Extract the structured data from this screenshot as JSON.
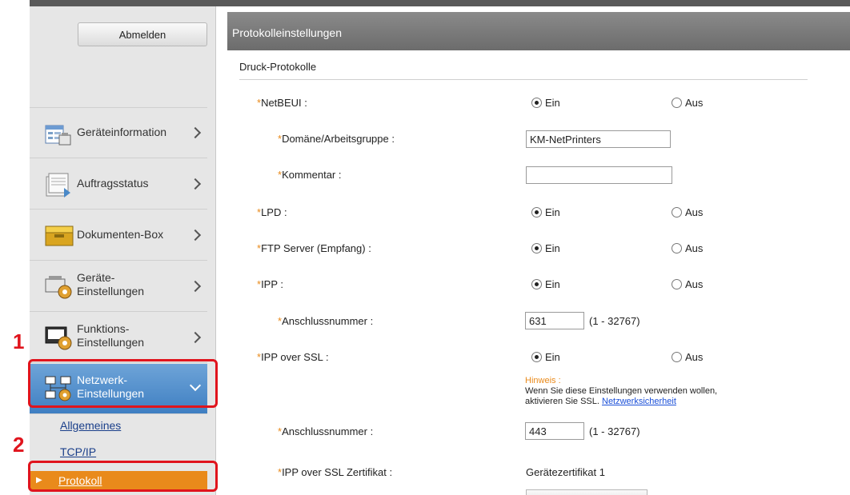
{
  "sidebar": {
    "logout_label": "Abmelden",
    "items": [
      {
        "label": "Geräteinformation",
        "icon": "device-info-icon"
      },
      {
        "label": "Auftragsstatus",
        "icon": "job-status-icon"
      },
      {
        "label": "Dokumenten-Box",
        "icon": "document-box-icon"
      },
      {
        "label_line1": "Geräte-",
        "label_line2": "Einstellungen",
        "icon": "device-settings-icon"
      },
      {
        "label_line1": "Funktions-",
        "label_line2": "Einstellungen",
        "icon": "function-settings-icon"
      },
      {
        "label_line1": "Netzwerk-",
        "label_line2": "Einstellungen",
        "icon": "network-settings-icon",
        "active": true
      }
    ],
    "sub_items": [
      "Allgemeines",
      "TCP/IP",
      "Protokoll"
    ],
    "active_sub_item": "Protokoll"
  },
  "callouts": [
    "1",
    "2"
  ],
  "panel": {
    "title": "Protokolleinstellungen",
    "section_title": "Druck-Protokolle",
    "required_mark": "*",
    "radio_on": "Ein",
    "radio_off": "Aus",
    "rows": {
      "netbeui": "NetBEUI :",
      "domain": "Domäne/Arbeitsgruppe :",
      "domain_value": "KM-NetPrinters",
      "comment": "Kommentar :",
      "comment_value": "",
      "lpd": "LPD :",
      "ftp": "FTP Server (Empfang) :",
      "ipp": "IPP :",
      "port": "Anschlussnummer :",
      "ipp_port_value": "631",
      "port_range": "(1 - 32767)",
      "ipp_ssl": "IPP over SSL :",
      "ipp_ssl_port_value": "443",
      "ipp_ssl_cert": "IPP over SSL Zertifikat :",
      "cert_value": "Gerätezertifikat 1"
    },
    "hint": {
      "title": "Hinweis :",
      "line1": "Wenn Sie diese Einstellungen verwenden wollen,",
      "line2": "aktivieren Sie SSL.",
      "link": "Netzwerksicherheit"
    }
  },
  "colors": {
    "accent_orange": "#e98a1b",
    "callout_red": "#e0141d",
    "active_blue": "#4a89c8"
  }
}
